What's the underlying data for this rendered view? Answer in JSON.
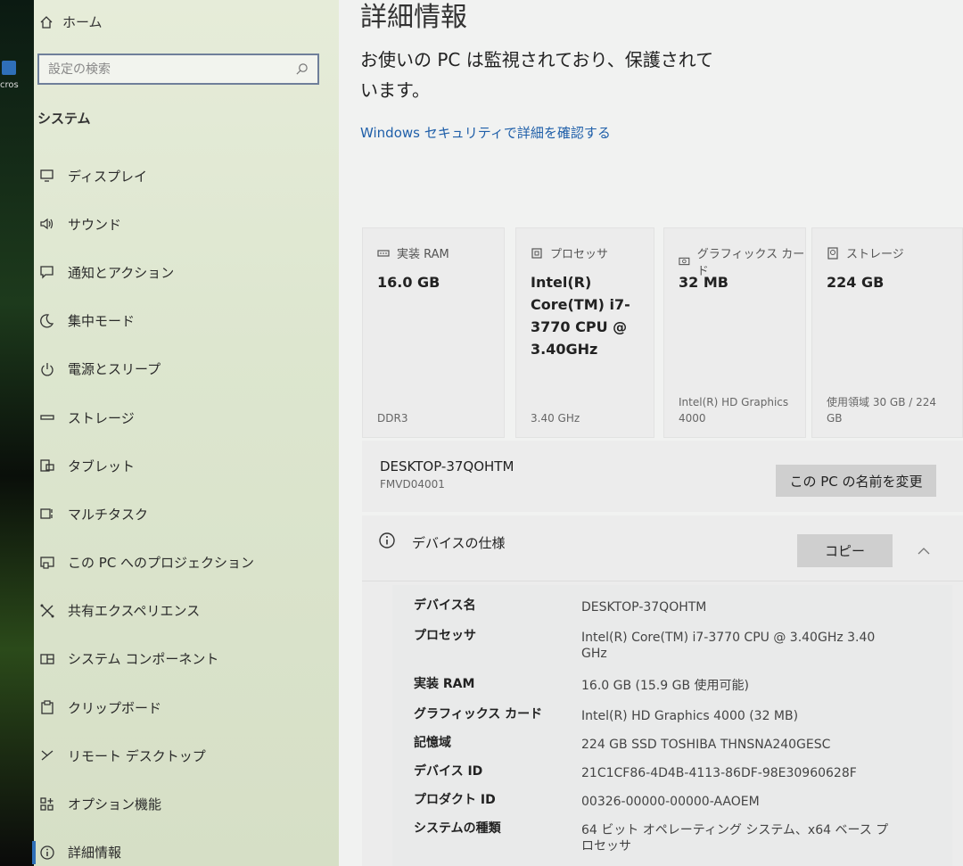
{
  "desktop": {
    "label": "cros"
  },
  "sidebar": {
    "home_label": "ホーム",
    "search_placeholder": "設定の検索",
    "section_title": "システム",
    "items": [
      {
        "label": "ディスプレイ",
        "icon": "monitor-icon"
      },
      {
        "label": "サウンド",
        "icon": "speaker-icon"
      },
      {
        "label": "通知とアクション",
        "icon": "notification-icon"
      },
      {
        "label": "集中モード",
        "icon": "moon-icon"
      },
      {
        "label": "電源とスリープ",
        "icon": "power-icon"
      },
      {
        "label": "ストレージ",
        "icon": "storage-icon"
      },
      {
        "label": "タブレット",
        "icon": "tablet-icon"
      },
      {
        "label": "マルチタスク",
        "icon": "multitask-icon"
      },
      {
        "label": "この PC へのプロジェクション",
        "icon": "projection-icon"
      },
      {
        "label": "共有エクスペリエンス",
        "icon": "share-icon"
      },
      {
        "label": "システム コンポーネント",
        "icon": "component-icon"
      },
      {
        "label": "クリップボード",
        "icon": "clipboard-icon"
      },
      {
        "label": "リモート デスクトップ",
        "icon": "remote-icon"
      },
      {
        "label": "オプション機能",
        "icon": "options-icon"
      },
      {
        "label": "詳細情報",
        "icon": "info-icon"
      }
    ]
  },
  "main": {
    "title": "詳細情報",
    "protection_text": "お使いの PC は監視されており、保護されています。",
    "security_link": "Windows セキュリティで詳細を確認する",
    "cards": [
      {
        "header": "実装 RAM",
        "value": "16.0 GB",
        "sub": "DDR3",
        "icon": "ram-icon"
      },
      {
        "header": "プロセッサ",
        "value": "Intel(R) Core(TM) i7-3770 CPU @ 3.40GHz",
        "sub": "3.40 GHz",
        "icon": "cpu-icon"
      },
      {
        "header": "グラフィックス カード",
        "value": "32 MB",
        "sub": "Intel(R) HD Graphics 4000",
        "icon": "gpu-icon"
      },
      {
        "header": "ストレージ",
        "value": "224 GB",
        "sub": "使用領域 30 GB / 224 GB",
        "icon": "storage-card-icon"
      }
    ],
    "device_name": "DESKTOP-37QOHTM",
    "model": "FMVD04001",
    "rename_button": "この PC の名前を変更",
    "spec": {
      "title": "デバイスの仕様",
      "copy_button": "コピー",
      "rows": [
        {
          "label": "デバイス名",
          "value": "DESKTOP-37QOHTM"
        },
        {
          "label": "プロセッサ",
          "value": "Intel(R) Core(TM) i7-3770 CPU @ 3.40GHz   3.40 GHz"
        },
        {
          "label": "実装 RAM",
          "value": "16.0 GB (15.9 GB 使用可能)"
        },
        {
          "label": "グラフィックス カード",
          "value": "Intel(R) HD Graphics 4000 (32 MB)"
        },
        {
          "label": "記憶域",
          "value": "224 GB SSD TOSHIBA THNSNA240GESC"
        },
        {
          "label": "デバイス ID",
          "value": "21C1CF86-4D4B-4113-86DF-98E30960628F"
        },
        {
          "label": "プロダクト ID",
          "value": "00326-00000-00000-AAOEM"
        },
        {
          "label": "システムの種類",
          "value": "64 ビット オペレーティング システム、x64 ベース プロセッサ"
        }
      ]
    }
  }
}
